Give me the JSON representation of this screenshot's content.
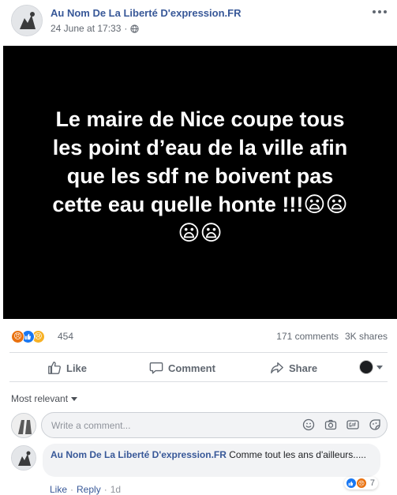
{
  "post": {
    "page_name": "Au Nom De La Liberté D'expression.FR",
    "timestamp": "24 June at 17:33",
    "image_text": "Le maire de Nice coupe tous\nles point d’eau de la ville afin\nque les sdf ne boivent pas\ncette eau quelle honte !!!😦😦\n😦😦",
    "reaction_count": "454",
    "comments_count": "171 comments",
    "shares_count": "3K shares"
  },
  "actions": {
    "like_label": "Like",
    "comment_label": "Comment",
    "share_label": "Share"
  },
  "comments": {
    "sort_label": "Most relevant",
    "composer_placeholder": "Write a comment...",
    "items": [
      {
        "author": "Au Nom De La Liberté D'expression.FR",
        "text": "Comme tout les ans d'ailleurs.....",
        "reaction_count": "7",
        "like_label": "Like",
        "reply_label": "Reply",
        "time": "1d"
      }
    ]
  },
  "colors": {
    "link": "#385898",
    "like_blue": "#1877f2",
    "angry_orange": "#e9710f",
    "sad_yellow": "#f7b125",
    "image_bg": "#000000"
  }
}
